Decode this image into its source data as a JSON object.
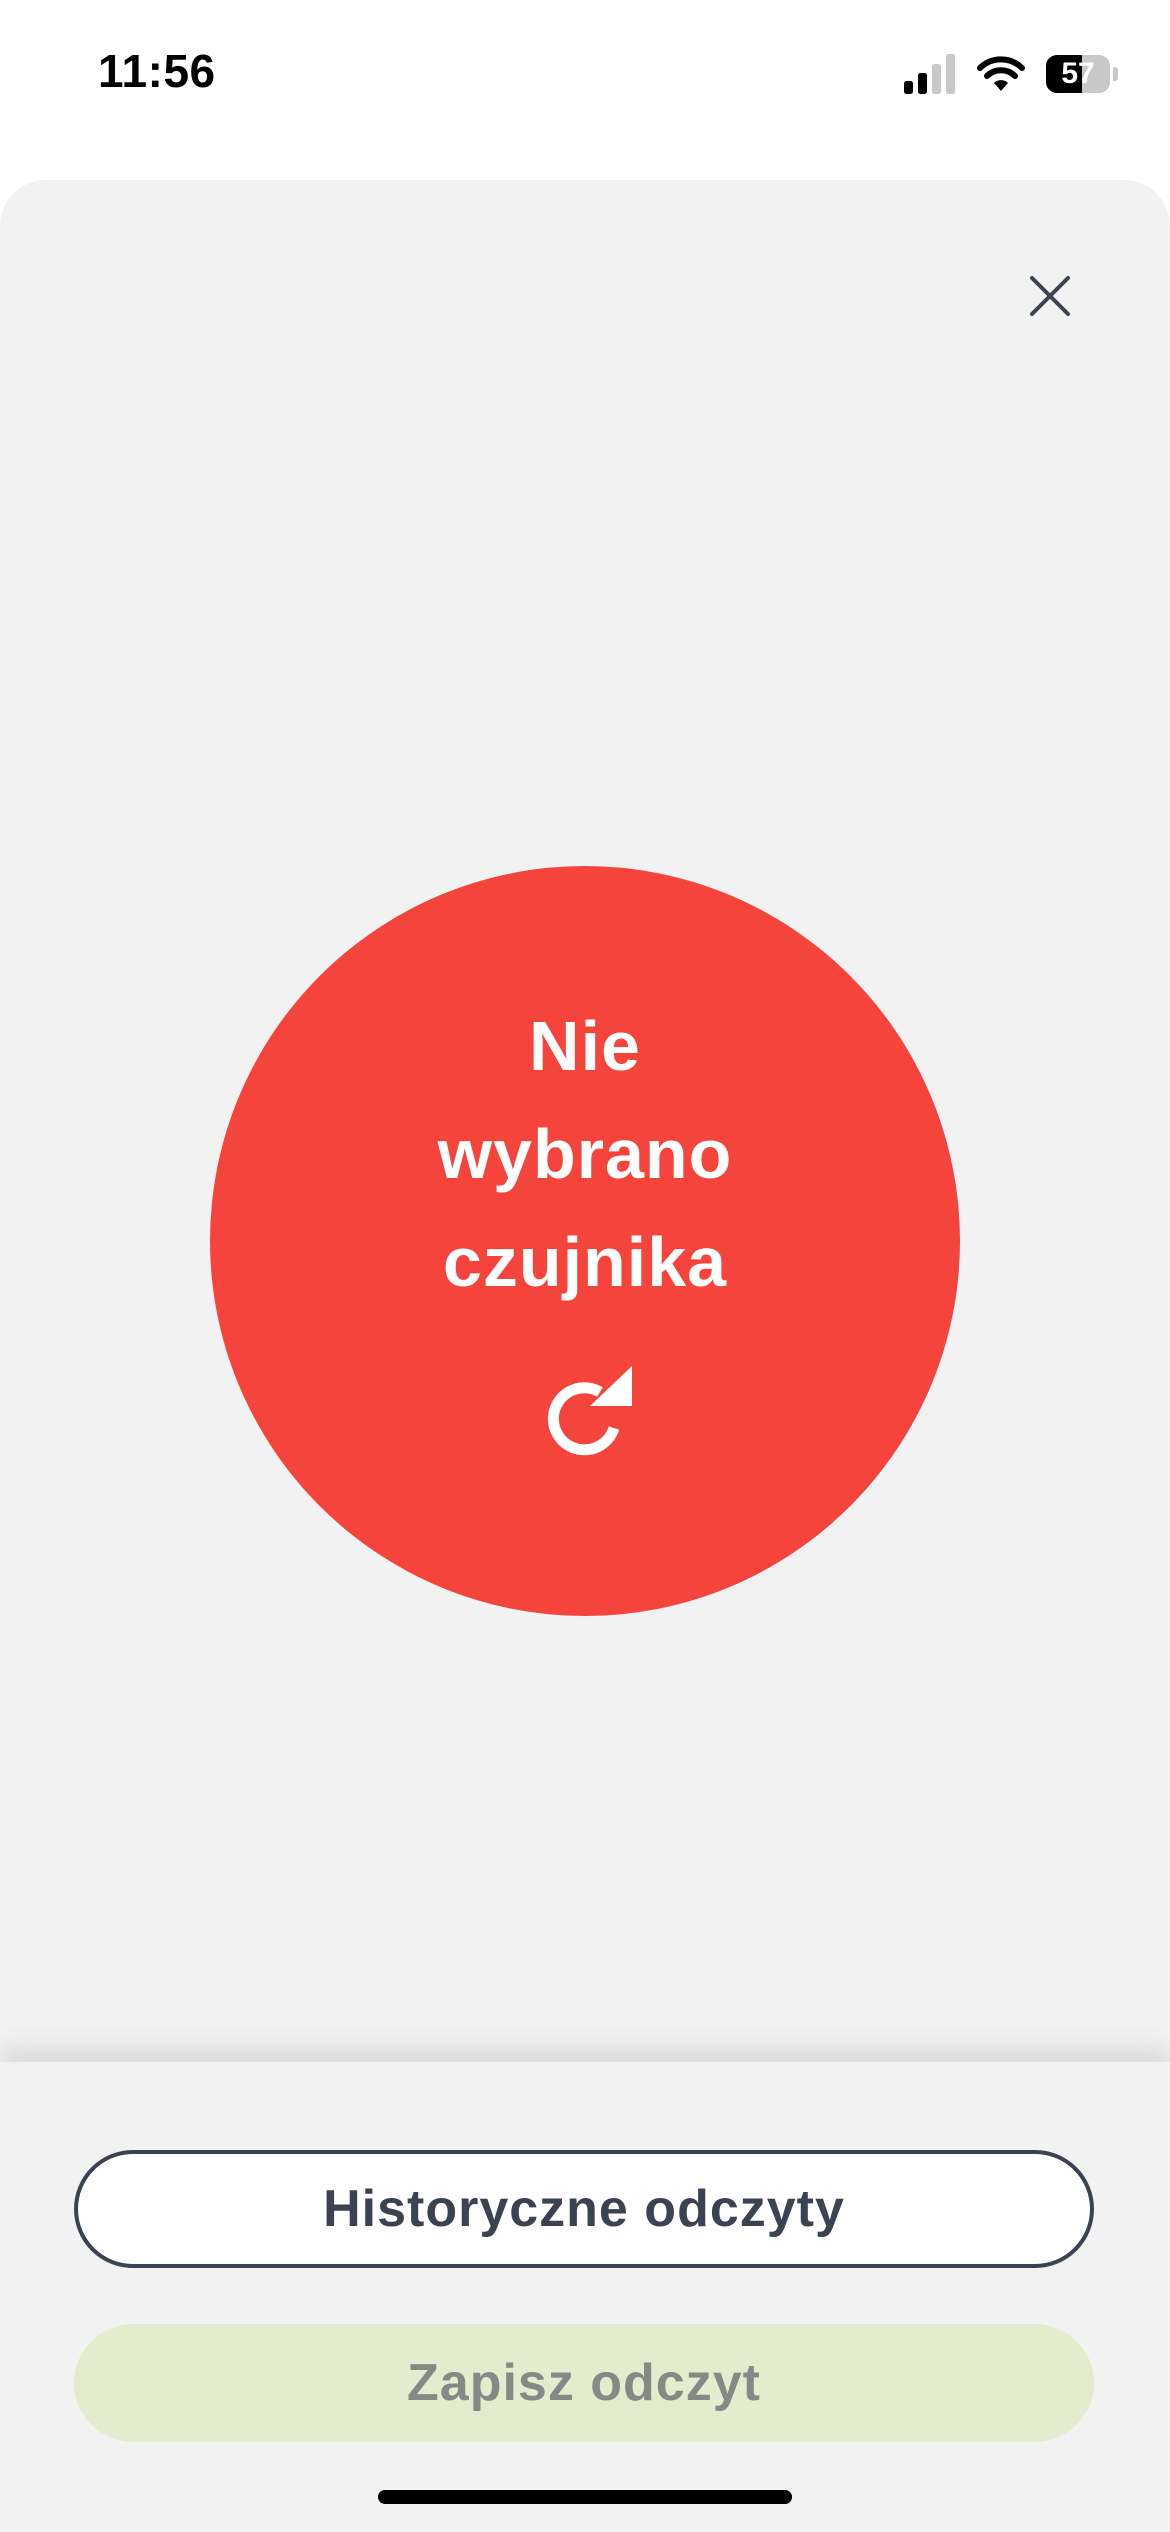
{
  "status_bar": {
    "time": "11:56",
    "battery_level": "57",
    "battery_fill_fraction": 0.57,
    "icons": [
      "signal-icon",
      "wifi-icon",
      "battery-icon"
    ]
  },
  "sheet": {
    "close_icon": "close-icon",
    "sensor_message": "Nie\nwybrano\nczujnika",
    "sensor_action_icon": "refresh-icon",
    "colors": {
      "sensor_circle": "#f4443b",
      "sheet_background": "#f2f2f3"
    }
  },
  "actions": {
    "history_label": "Historyczne odczyty",
    "save_label": "Zapisz odczyt",
    "colors": {
      "history_border": "#3b4251",
      "save_background": "#e3eccd",
      "save_text": "#858a86"
    }
  }
}
